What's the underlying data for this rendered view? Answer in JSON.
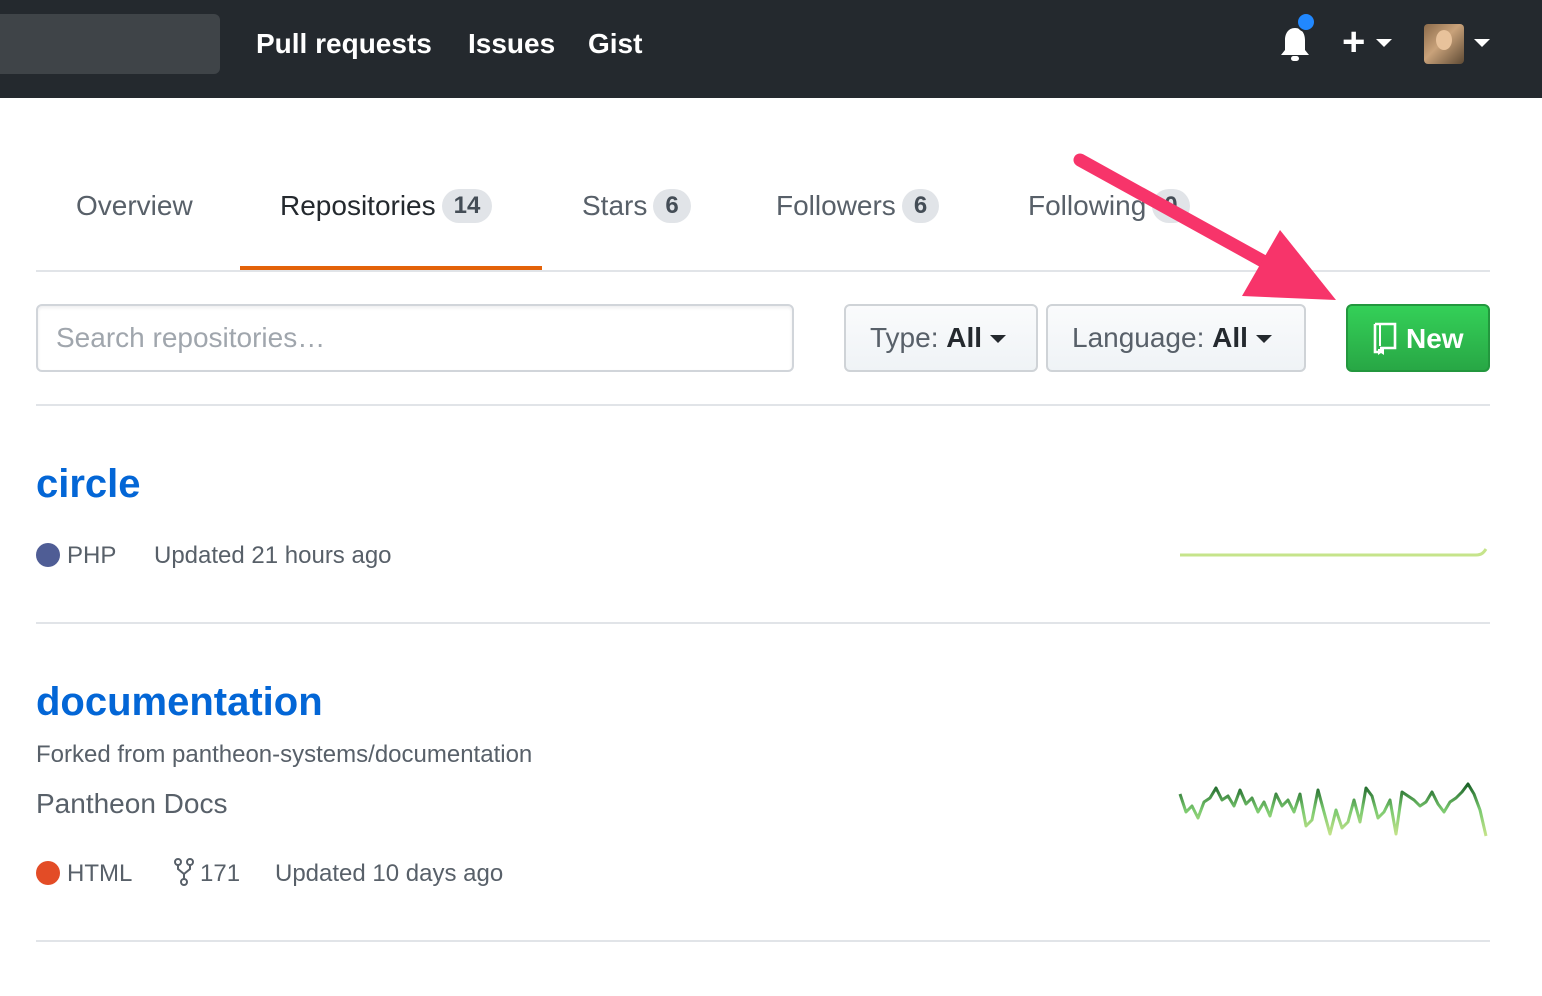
{
  "header": {
    "nav": [
      "Pull requests",
      "Issues",
      "Gist"
    ],
    "icons": [
      "bell-icon",
      "plus-icon",
      "avatar"
    ],
    "colors": {
      "bg": "#24292e",
      "notification_dot": "#2188ff"
    }
  },
  "tabs": [
    {
      "label": "Overview",
      "count": null
    },
    {
      "label": "Repositories",
      "count": "14",
      "active": true
    },
    {
      "label": "Stars",
      "count": "6"
    },
    {
      "label": "Followers",
      "count": "6"
    },
    {
      "label": "Following",
      "count": "0"
    }
  ],
  "filters": {
    "search_placeholder": "Search repositories…",
    "type_label": "Type:",
    "type_value": "All",
    "language_label": "Language:",
    "language_value": "All",
    "new_label": "New"
  },
  "repos": [
    {
      "name": "circle",
      "language": "PHP",
      "language_color": "#4F5D95",
      "updated": "Updated 21 hours ago"
    },
    {
      "name": "documentation",
      "forked_prefix": "Forked from",
      "forked_from": "pantheon-systems/documentation",
      "description": "Pantheon Docs",
      "language": "HTML",
      "language_color": "#e34c26",
      "forks": "171",
      "updated": "Updated 10 days ago"
    }
  ],
  "accent_colors": {
    "tab_underline": "#e36209",
    "new_button": "#28a745",
    "link": "#0366d6",
    "annotation_arrow": "#f7346a"
  }
}
